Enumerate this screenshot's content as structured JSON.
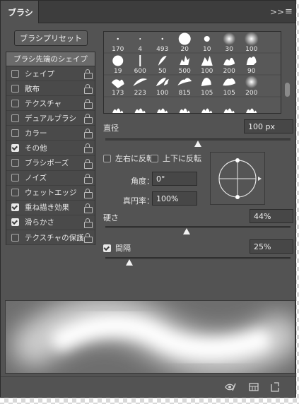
{
  "panel": {
    "tab_label": "ブラシ",
    "collapse_icon": "double-chevron-icon",
    "menu_icon": "hamburger-menu-icon"
  },
  "preset_button": {
    "label": "ブラシプリセット"
  },
  "sidebar": {
    "header": "ブラシ先端のシェイプ",
    "items": [
      {
        "label": "シェイプ",
        "checked": false
      },
      {
        "label": "散布",
        "checked": false
      },
      {
        "label": "テクスチャ",
        "checked": false
      },
      {
        "label": "デュアルブラシ",
        "checked": false
      },
      {
        "label": "カラー",
        "checked": false
      },
      {
        "label": "その他",
        "checked": true
      },
      {
        "label": "ブラシポーズ",
        "checked": false
      },
      {
        "label": "ノイズ",
        "checked": false
      },
      {
        "label": "ウェットエッジ",
        "checked": false
      },
      {
        "label": "重ね描き効果",
        "checked": true
      },
      {
        "label": "滑らかさ",
        "checked": true
      },
      {
        "label": "テクスチャの保護",
        "checked": false
      }
    ]
  },
  "brush_grid": {
    "row1": [
      "170",
      "4",
      "493",
      "20",
      "10",
      "30",
      "100"
    ],
    "row2": [
      "19",
      "600",
      "50",
      "500",
      "100",
      "200",
      "90"
    ],
    "row3": [
      "173",
      "223",
      "100",
      "815",
      "105",
      "105",
      "200"
    ]
  },
  "diameter": {
    "label": "直径",
    "value": "100 px",
    "level": 0.5
  },
  "flip": {
    "x_label": "左右に反転",
    "y_label": "上下に反転"
  },
  "angle": {
    "label": "角度：",
    "value": "0°"
  },
  "roundness": {
    "label": "真円率：",
    "value": "100%"
  },
  "hardness": {
    "label": "硬さ",
    "value": "44%",
    "level": 0.44
  },
  "spacing": {
    "label": "間隔",
    "value": "25%",
    "checked": true,
    "level": 0.13
  },
  "bottom_icons": [
    "eye-brush-icon",
    "grid-panel-icon",
    "new-brush-icon"
  ],
  "colors": {
    "panel": "#535353",
    "titlebar": "#3d3d3d",
    "text": "#e6e6e6"
  }
}
